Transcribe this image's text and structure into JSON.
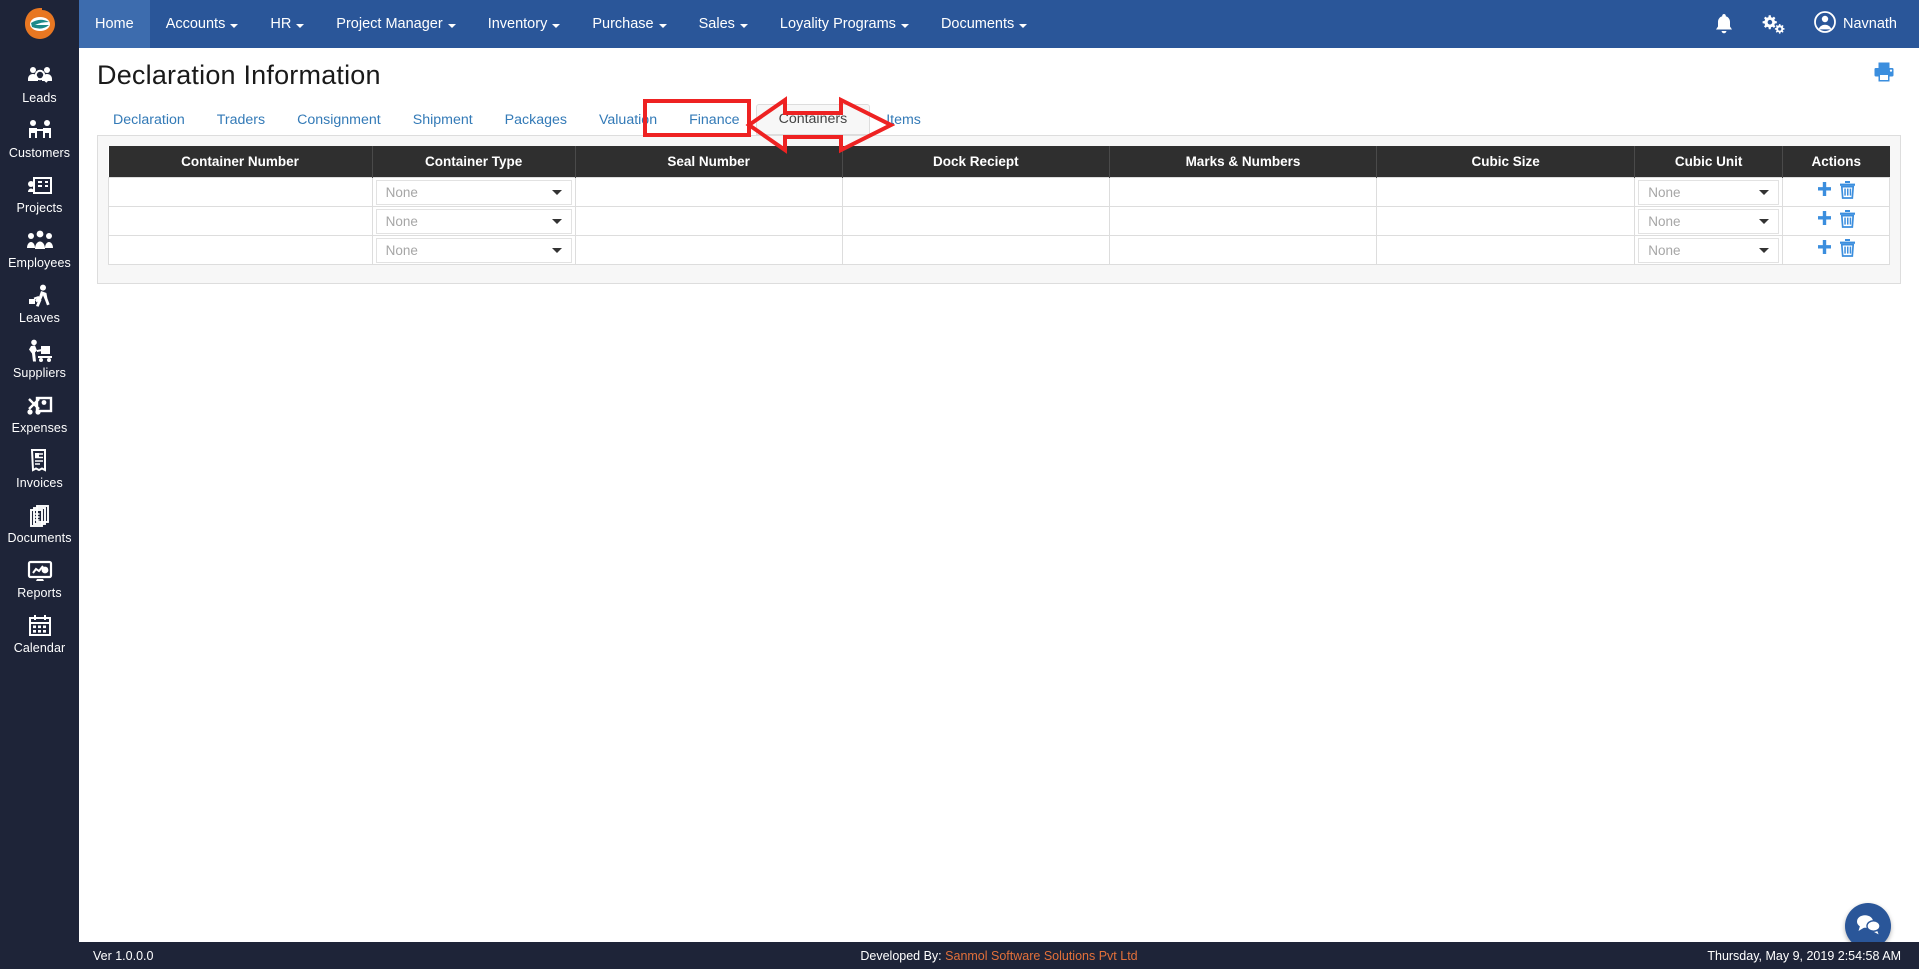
{
  "brand": {
    "logo_icon": "e-logo-icon",
    "colors": {
      "sidebar_bg": "#1e2438",
      "topnav_bg": "#2a5699",
      "topnav_active": "#3d6cae",
      "link_blue": "#337ab7",
      "table_header_bg": "#2f2f2f",
      "accent_orange": "#e2703a",
      "annotation_red": "#ee2222",
      "action_icon_blue": "#3b8ede"
    }
  },
  "topnav": {
    "items": [
      {
        "label": "Home",
        "has_caret": false,
        "active": true
      },
      {
        "label": "Accounts",
        "has_caret": true,
        "active": false
      },
      {
        "label": "HR",
        "has_caret": true,
        "active": false
      },
      {
        "label": "Project Manager",
        "has_caret": true,
        "active": false
      },
      {
        "label": "Inventory",
        "has_caret": true,
        "active": false
      },
      {
        "label": "Purchase",
        "has_caret": true,
        "active": false
      },
      {
        "label": "Sales",
        "has_caret": true,
        "active": false
      },
      {
        "label": "Loyality Programs",
        "has_caret": true,
        "active": false
      },
      {
        "label": "Documents",
        "has_caret": true,
        "active": false
      }
    ],
    "notification_icon": "bell-icon",
    "settings_icon": "gears-icon",
    "user_icon": "user-avatar-icon",
    "user_name": "Navnath"
  },
  "sidebar": {
    "items": [
      {
        "label": "Leads",
        "icon": "leads-icon"
      },
      {
        "label": "Customers",
        "icon": "customers-icon"
      },
      {
        "label": "Projects",
        "icon": "projects-icon"
      },
      {
        "label": "Employees",
        "icon": "employees-icon"
      },
      {
        "label": "Leaves",
        "icon": "leaves-icon"
      },
      {
        "label": "Suppliers",
        "icon": "suppliers-icon"
      },
      {
        "label": "Expenses",
        "icon": "expenses-icon"
      },
      {
        "label": "Invoices",
        "icon": "invoices-icon"
      },
      {
        "label": "Documents",
        "icon": "documents-icon"
      },
      {
        "label": "Reports",
        "icon": "reports-icon"
      },
      {
        "label": "Calendar",
        "icon": "calendar-icon"
      }
    ]
  },
  "page": {
    "title": "Declaration Information",
    "print_icon": "printer-icon"
  },
  "tabs": {
    "items": [
      {
        "label": "Declaration",
        "active": false
      },
      {
        "label": "Traders",
        "active": false
      },
      {
        "label": "Consignment",
        "active": false
      },
      {
        "label": "Shipment",
        "active": false
      },
      {
        "label": "Packages",
        "active": false
      },
      {
        "label": "Valuation",
        "active": false
      },
      {
        "label": "Finance",
        "active": false
      },
      {
        "label": "Containers",
        "active": true
      },
      {
        "label": "Items",
        "active": false
      }
    ],
    "annotation": {
      "highlighted_tab": "Containers",
      "arrow_icon": "left-pointing-arrow-annotation",
      "color": "#ee2222"
    }
  },
  "table": {
    "columns": [
      "Container Number",
      "Container Type",
      "Seal Number",
      "Dock Reciept",
      "Marks & Numbers",
      "Cubic Size",
      "Cubic Unit",
      "Actions"
    ],
    "rows": [
      {
        "container_number": "",
        "container_type": "None",
        "seal_number": "",
        "dock_reciept": "",
        "marks_numbers": "",
        "cubic_size": "",
        "cubic_unit": "None",
        "add_icon": "plus-icon",
        "delete_icon": "trash-icon"
      },
      {
        "container_number": "",
        "container_type": "None",
        "seal_number": "",
        "dock_reciept": "",
        "marks_numbers": "",
        "cubic_size": "",
        "cubic_unit": "None",
        "add_icon": "plus-icon",
        "delete_icon": "trash-icon"
      },
      {
        "container_number": "",
        "container_type": "None",
        "seal_number": "",
        "dock_reciept": "",
        "marks_numbers": "",
        "cubic_size": "",
        "cubic_unit": "None",
        "add_icon": "plus-icon",
        "delete_icon": "trash-icon"
      }
    ]
  },
  "chat": {
    "icon": "chat-bubbles-icon"
  },
  "footer": {
    "version": "Ver 1.0.0.0",
    "developed_by_label": "Developed By:",
    "company": "Sanmol Software Solutions Pvt Ltd",
    "datetime": "Thursday, May 9, 2019 2:54:58 AM"
  }
}
